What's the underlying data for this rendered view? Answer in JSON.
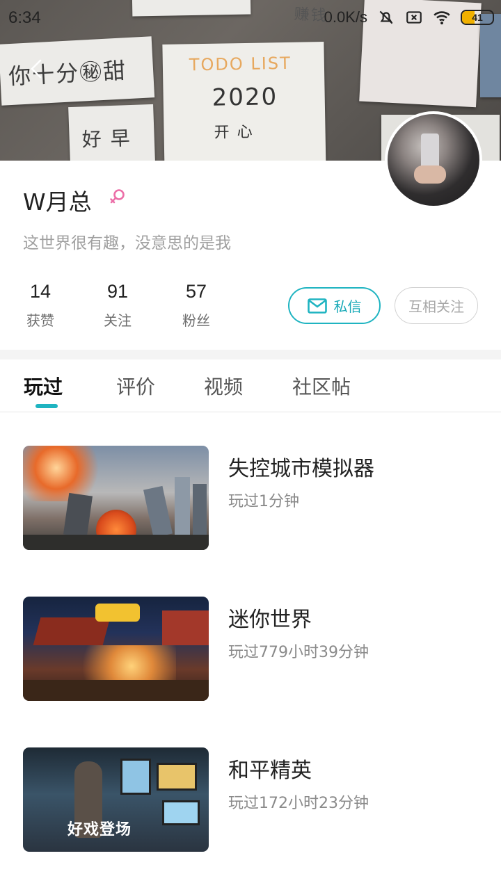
{
  "status_bar": {
    "time": "6:34",
    "net_speed": "0.0K/s",
    "battery": "41",
    "battery_color": "#f0b000"
  },
  "cover": {
    "notes": [
      "你十分㊙甜",
      "TODO LIST",
      "2020",
      "开 心",
      "好 早",
      "赚钱"
    ],
    "icons": [
      "back-arrow-icon"
    ]
  },
  "profile": {
    "name": "W月总",
    "gender_icon": "female-icon",
    "bio": "这世界很有趣，没意思的是我",
    "stats": [
      {
        "value": "14",
        "label": "获赞"
      },
      {
        "value": "91",
        "label": "关注"
      },
      {
        "value": "57",
        "label": "粉丝"
      }
    ],
    "message_button": "私信",
    "follow_button": "互相关注",
    "accent": "#1fb4c1"
  },
  "tabs": [
    {
      "label": "玩过",
      "active": true
    },
    {
      "label": "评价",
      "active": false
    },
    {
      "label": "视频",
      "active": false
    },
    {
      "label": "社区帖",
      "active": false
    }
  ],
  "games": [
    {
      "title": "失控城市模拟器",
      "played": "玩过1分钟"
    },
    {
      "title": "迷你世界",
      "played": "玩过779小时39分钟"
    },
    {
      "title": "和平精英",
      "played": "玩过172小时23分钟",
      "banner": "好戏登场"
    }
  ]
}
